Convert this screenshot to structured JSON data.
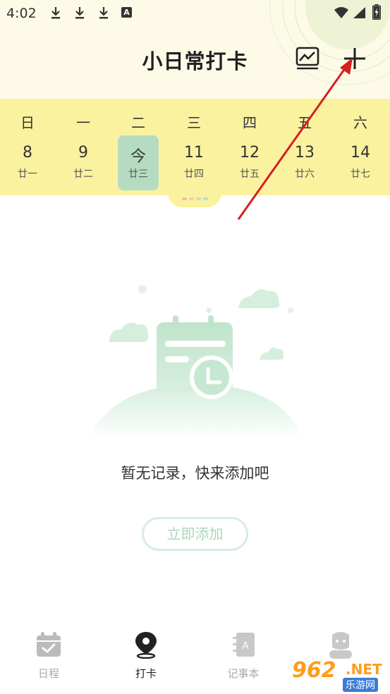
{
  "status_bar": {
    "time": "4:02",
    "icons": [
      "download-icon",
      "download-icon",
      "download-icon",
      "font-icon",
      "wifi-icon",
      "signal-icon",
      "battery-icon"
    ],
    "a_glyph": "A"
  },
  "header": {
    "title": "小日常打卡",
    "actions": [
      "stats-chart-icon",
      "add-icon"
    ]
  },
  "week": {
    "days": [
      {
        "name": "日",
        "date": "8",
        "lunar": "廿一",
        "today": false
      },
      {
        "name": "一",
        "date": "9",
        "lunar": "廿二",
        "today": false
      },
      {
        "name": "二",
        "date": "今",
        "lunar": "廿三",
        "today": true
      },
      {
        "name": "三",
        "date": "11",
        "lunar": "廿四",
        "today": false
      },
      {
        "name": "四",
        "date": "12",
        "lunar": "廿五",
        "today": false
      },
      {
        "name": "五",
        "date": "13",
        "lunar": "廿六",
        "today": false
      },
      {
        "name": "六",
        "date": "14",
        "lunar": "廿七",
        "today": false
      }
    ]
  },
  "empty_state": {
    "message": "暂无记录，快来添加吧",
    "button_label": "立即添加"
  },
  "bottom_nav": {
    "items": [
      {
        "label": "日程",
        "icon": "calendar-check-icon",
        "active": false
      },
      {
        "label": "打卡",
        "icon": "map-pin-icon",
        "active": true
      },
      {
        "label": "记事本",
        "icon": "notebook-icon",
        "active": false
      },
      {
        "label": "",
        "icon": "profile-icon",
        "active": false
      }
    ]
  },
  "watermark": {
    "number": "962",
    "suffix": ".NET",
    "site": "乐游网"
  },
  "colors": {
    "header_bg": "#fdfbe8",
    "week_bg": "#fbf2a0",
    "today_bg": "#b5dcc0",
    "accent_green": "#a9d8b8",
    "arrow_red": "#d42020"
  }
}
